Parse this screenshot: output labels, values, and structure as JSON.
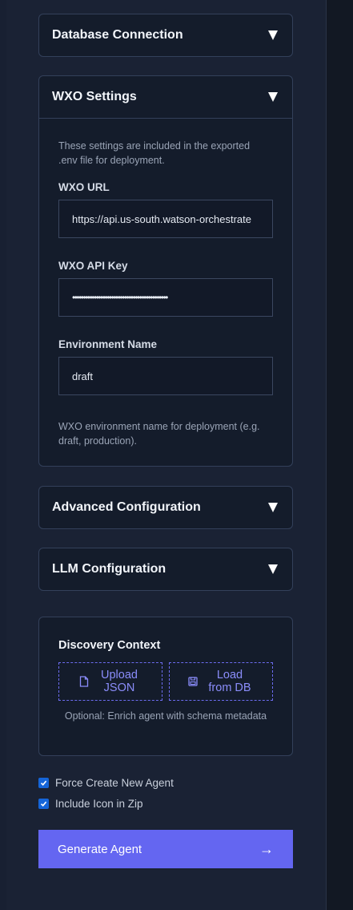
{
  "panels": {
    "database": {
      "title": "Database Connection"
    },
    "wxo": {
      "title": "WXO Settings",
      "intro": "These settings are included in the exported .env file for deployment.",
      "url_label": "WXO URL",
      "url_value": "https://api.us-south.watson-orchestrate",
      "api_key_label": "WXO API Key",
      "api_key_value": "••••••••••••••••••••••••••••••••••••••••••••",
      "env_label": "Environment Name",
      "env_value": "draft",
      "env_hint": "WXO environment name for deployment (e.g. draft, production)."
    },
    "advanced": {
      "title": "Advanced Configuration"
    },
    "llm": {
      "title": "LLM Configuration"
    }
  },
  "discovery": {
    "title": "Discovery Context",
    "upload_label": "Upload JSON",
    "load_label": "Load from DB",
    "hint": "Optional: Enrich agent with schema metadata"
  },
  "options": {
    "force_create": {
      "label": "Force Create New Agent",
      "checked": true
    },
    "include_icon": {
      "label": "Include Icon in Zip",
      "checked": true
    }
  },
  "generate": {
    "label": "Generate Agent",
    "arrow": "→"
  },
  "colors": {
    "accent": "#6466f1",
    "background": "#1a2234",
    "panel": "#141c2b",
    "checkbox": "#1565d8"
  }
}
